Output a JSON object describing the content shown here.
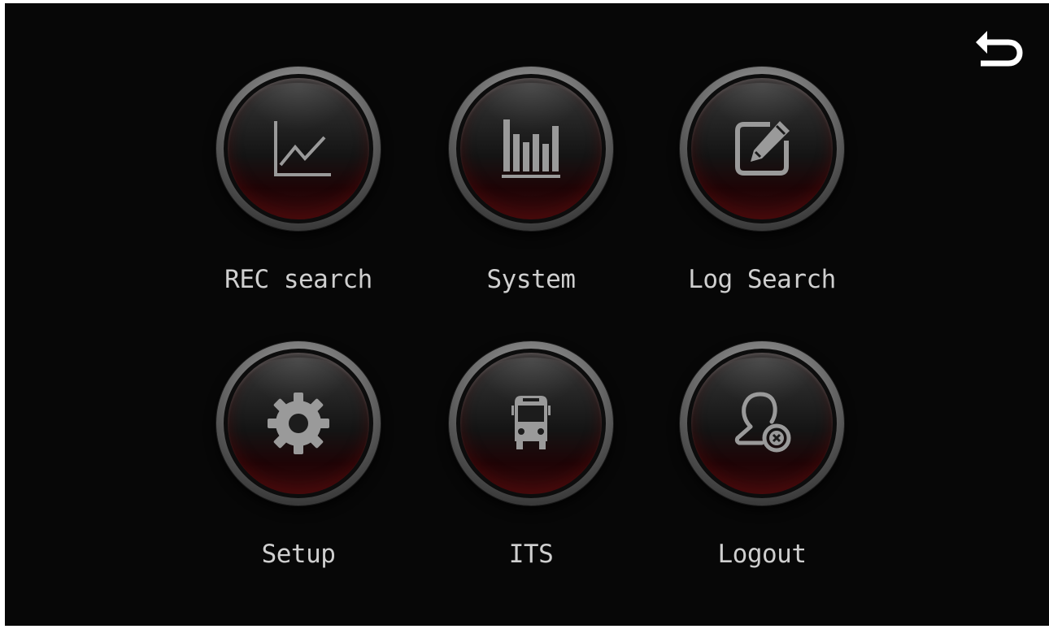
{
  "colors": {
    "background": "#070707",
    "label": "#cfcfcf",
    "icon": "#9a9a9a",
    "accent_red": "#3a0a0c"
  },
  "header": {
    "back_icon": "back-arrow-icon"
  },
  "menu": {
    "items": [
      {
        "label": "REC search",
        "icon": "line-chart-icon"
      },
      {
        "label": "System",
        "icon": "bar-chart-icon"
      },
      {
        "label": "Log Search",
        "icon": "edit-log-icon"
      },
      {
        "label": "Setup",
        "icon": "gear-icon"
      },
      {
        "label": "ITS",
        "icon": "bus-icon"
      },
      {
        "label": "Logout",
        "icon": "user-remove-icon"
      }
    ]
  }
}
